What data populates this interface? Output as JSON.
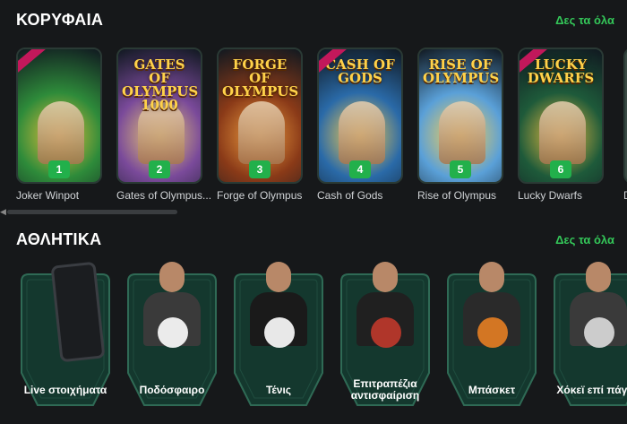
{
  "sections": {
    "top": {
      "title": "ΚΟΡΥΦΑΙΑ",
      "see_all": "Δες τα όλα"
    },
    "sports": {
      "title": "ΑΘΛΗΤΙΚΑ",
      "see_all": "Δες τα όλα"
    }
  },
  "games": [
    {
      "rank": "1",
      "name": "Joker Winpot",
      "logo": "",
      "bg": "#2e8b3a",
      "accent": "#e8c13a",
      "new": true
    },
    {
      "rank": "2",
      "name": "Gates of Olympus...",
      "logo": "GATES OF OLYMPUS 1000",
      "bg": "#7a4a9a",
      "accent": "#f0d070",
      "new": false
    },
    {
      "rank": "3",
      "name": "Forge of Olympus",
      "logo": "FORGE OF OLYMPUS",
      "bg": "#8a3a18",
      "accent": "#f0a040",
      "new": false
    },
    {
      "rank": "4",
      "name": "Cash of Gods",
      "logo": "CASH OF GODS",
      "bg": "#2a6aa8",
      "accent": "#ffd24a",
      "new": true
    },
    {
      "rank": "5",
      "name": "Rise of Olympus",
      "logo": "RISE OF OLYMPUS",
      "bg": "#5aa0d8",
      "accent": "#ffd24a",
      "new": false
    },
    {
      "rank": "6",
      "name": "Lucky Dwarfs",
      "logo": "LUCKY DWARFS",
      "bg": "#1e5a3a",
      "accent": "#f0c040",
      "new": true
    }
  ],
  "partial_game_name": "D",
  "sports_items": [
    {
      "label": "Live στοιχήματα",
      "type": "phone"
    },
    {
      "label": "Ποδόσφαιρο",
      "type": "football"
    },
    {
      "label": "Τένις",
      "type": "tennis"
    },
    {
      "label": "Επιτραπέζια αντισφαίριση",
      "type": "pingpong"
    },
    {
      "label": "Μπάσκετ",
      "type": "basketball"
    },
    {
      "label": "Χόκεϊ επί πάγου",
      "type": "hockey"
    }
  ],
  "colors": {
    "accent_green": "#34c759",
    "badge_green": "#22b04b",
    "card_border": "#2a5a48",
    "background": "#16181a"
  }
}
